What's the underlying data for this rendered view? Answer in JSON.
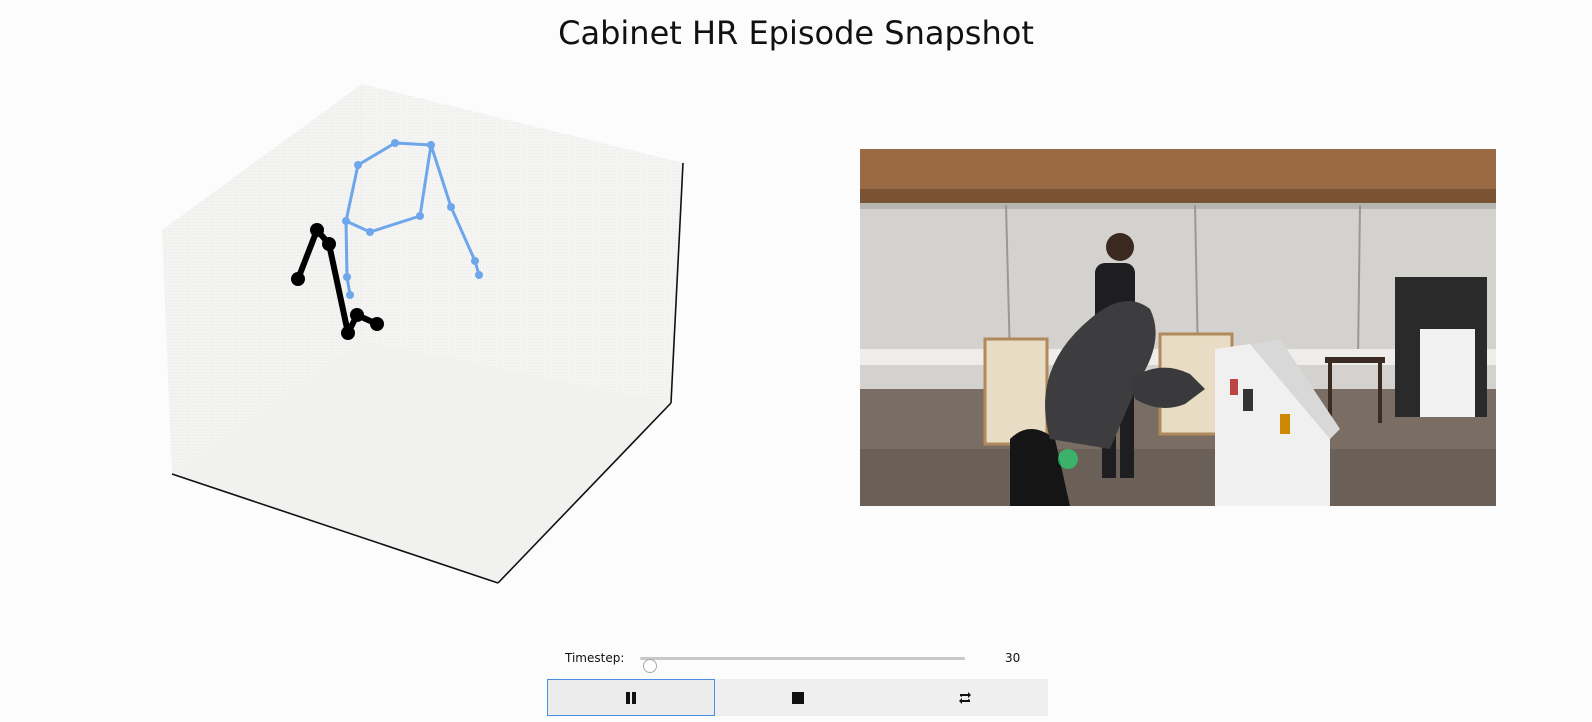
{
  "title": "Cabinet HR Episode Snapshot",
  "controls": {
    "timestep_label": "Timestep:",
    "timestep_value": "30",
    "slider_fraction": 0.03,
    "buttons": [
      {
        "icon": "pause-icon"
      },
      {
        "icon": "stop-icon"
      },
      {
        "icon": "loop-icon"
      }
    ]
  },
  "scene": {
    "human_color": "#6ea6ec",
    "robot_color": "#000000"
  },
  "video_frame": {
    "description_icon": "video-frame"
  }
}
